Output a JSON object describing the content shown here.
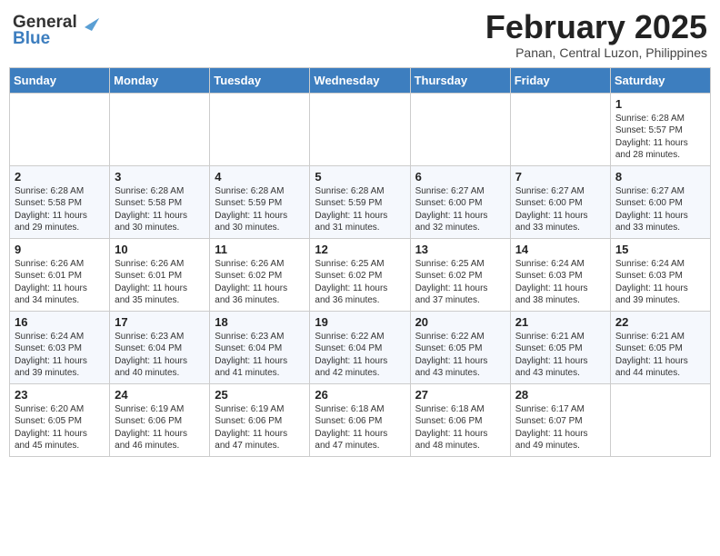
{
  "header": {
    "logo_general": "General",
    "logo_blue": "Blue",
    "month_year": "February 2025",
    "location": "Panan, Central Luzon, Philippines"
  },
  "weekdays": [
    "Sunday",
    "Monday",
    "Tuesday",
    "Wednesday",
    "Thursday",
    "Friday",
    "Saturday"
  ],
  "weeks": [
    [
      {
        "day": "",
        "info": ""
      },
      {
        "day": "",
        "info": ""
      },
      {
        "day": "",
        "info": ""
      },
      {
        "day": "",
        "info": ""
      },
      {
        "day": "",
        "info": ""
      },
      {
        "day": "",
        "info": ""
      },
      {
        "day": "1",
        "info": "Sunrise: 6:28 AM\nSunset: 5:57 PM\nDaylight: 11 hours\nand 28 minutes."
      }
    ],
    [
      {
        "day": "2",
        "info": "Sunrise: 6:28 AM\nSunset: 5:58 PM\nDaylight: 11 hours\nand 29 minutes."
      },
      {
        "day": "3",
        "info": "Sunrise: 6:28 AM\nSunset: 5:58 PM\nDaylight: 11 hours\nand 30 minutes."
      },
      {
        "day": "4",
        "info": "Sunrise: 6:28 AM\nSunset: 5:59 PM\nDaylight: 11 hours\nand 30 minutes."
      },
      {
        "day": "5",
        "info": "Sunrise: 6:28 AM\nSunset: 5:59 PM\nDaylight: 11 hours\nand 31 minutes."
      },
      {
        "day": "6",
        "info": "Sunrise: 6:27 AM\nSunset: 6:00 PM\nDaylight: 11 hours\nand 32 minutes."
      },
      {
        "day": "7",
        "info": "Sunrise: 6:27 AM\nSunset: 6:00 PM\nDaylight: 11 hours\nand 33 minutes."
      },
      {
        "day": "8",
        "info": "Sunrise: 6:27 AM\nSunset: 6:00 PM\nDaylight: 11 hours\nand 33 minutes."
      }
    ],
    [
      {
        "day": "9",
        "info": "Sunrise: 6:26 AM\nSunset: 6:01 PM\nDaylight: 11 hours\nand 34 minutes."
      },
      {
        "day": "10",
        "info": "Sunrise: 6:26 AM\nSunset: 6:01 PM\nDaylight: 11 hours\nand 35 minutes."
      },
      {
        "day": "11",
        "info": "Sunrise: 6:26 AM\nSunset: 6:02 PM\nDaylight: 11 hours\nand 36 minutes."
      },
      {
        "day": "12",
        "info": "Sunrise: 6:25 AM\nSunset: 6:02 PM\nDaylight: 11 hours\nand 36 minutes."
      },
      {
        "day": "13",
        "info": "Sunrise: 6:25 AM\nSunset: 6:02 PM\nDaylight: 11 hours\nand 37 minutes."
      },
      {
        "day": "14",
        "info": "Sunrise: 6:24 AM\nSunset: 6:03 PM\nDaylight: 11 hours\nand 38 minutes."
      },
      {
        "day": "15",
        "info": "Sunrise: 6:24 AM\nSunset: 6:03 PM\nDaylight: 11 hours\nand 39 minutes."
      }
    ],
    [
      {
        "day": "16",
        "info": "Sunrise: 6:24 AM\nSunset: 6:03 PM\nDaylight: 11 hours\nand 39 minutes."
      },
      {
        "day": "17",
        "info": "Sunrise: 6:23 AM\nSunset: 6:04 PM\nDaylight: 11 hours\nand 40 minutes."
      },
      {
        "day": "18",
        "info": "Sunrise: 6:23 AM\nSunset: 6:04 PM\nDaylight: 11 hours\nand 41 minutes."
      },
      {
        "day": "19",
        "info": "Sunrise: 6:22 AM\nSunset: 6:04 PM\nDaylight: 11 hours\nand 42 minutes."
      },
      {
        "day": "20",
        "info": "Sunrise: 6:22 AM\nSunset: 6:05 PM\nDaylight: 11 hours\nand 43 minutes."
      },
      {
        "day": "21",
        "info": "Sunrise: 6:21 AM\nSunset: 6:05 PM\nDaylight: 11 hours\nand 43 minutes."
      },
      {
        "day": "22",
        "info": "Sunrise: 6:21 AM\nSunset: 6:05 PM\nDaylight: 11 hours\nand 44 minutes."
      }
    ],
    [
      {
        "day": "23",
        "info": "Sunrise: 6:20 AM\nSunset: 6:05 PM\nDaylight: 11 hours\nand 45 minutes."
      },
      {
        "day": "24",
        "info": "Sunrise: 6:19 AM\nSunset: 6:06 PM\nDaylight: 11 hours\nand 46 minutes."
      },
      {
        "day": "25",
        "info": "Sunrise: 6:19 AM\nSunset: 6:06 PM\nDaylight: 11 hours\nand 47 minutes."
      },
      {
        "day": "26",
        "info": "Sunrise: 6:18 AM\nSunset: 6:06 PM\nDaylight: 11 hours\nand 47 minutes."
      },
      {
        "day": "27",
        "info": "Sunrise: 6:18 AM\nSunset: 6:06 PM\nDaylight: 11 hours\nand 48 minutes."
      },
      {
        "day": "28",
        "info": "Sunrise: 6:17 AM\nSunset: 6:07 PM\nDaylight: 11 hours\nand 49 minutes."
      },
      {
        "day": "",
        "info": ""
      }
    ]
  ]
}
